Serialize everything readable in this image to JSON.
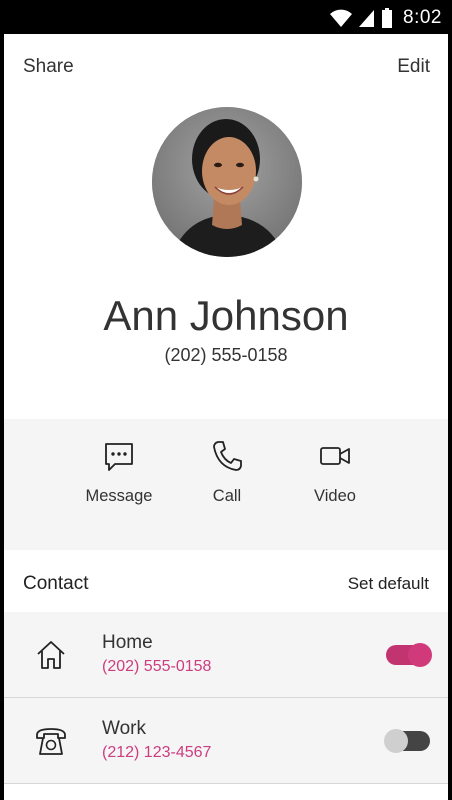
{
  "status_bar": {
    "time": "8:02",
    "icons": [
      "wifi-icon",
      "signal-icon",
      "battery-icon"
    ]
  },
  "header": {
    "share_label": "Share",
    "edit_label": "Edit"
  },
  "contact": {
    "name": "Ann Johnson",
    "phone": "(202) 555-0158"
  },
  "actions": [
    {
      "label": "Message",
      "icon": "message-icon"
    },
    {
      "label": "Call",
      "icon": "phone-icon"
    },
    {
      "label": "Video",
      "icon": "video-icon"
    }
  ],
  "section": {
    "title": "Contact",
    "set_default_label": "Set default"
  },
  "numbers": [
    {
      "label": "Home",
      "number": "(202) 555-0158",
      "icon": "home-icon",
      "default": true
    },
    {
      "label": "Work",
      "number": "(212) 123-4567",
      "icon": "desk-phone-icon",
      "default": false
    }
  ],
  "colors": {
    "accent": "#cc3d80",
    "toggle_on": "#c2346f",
    "panel_bg": "#f5f5f5"
  }
}
